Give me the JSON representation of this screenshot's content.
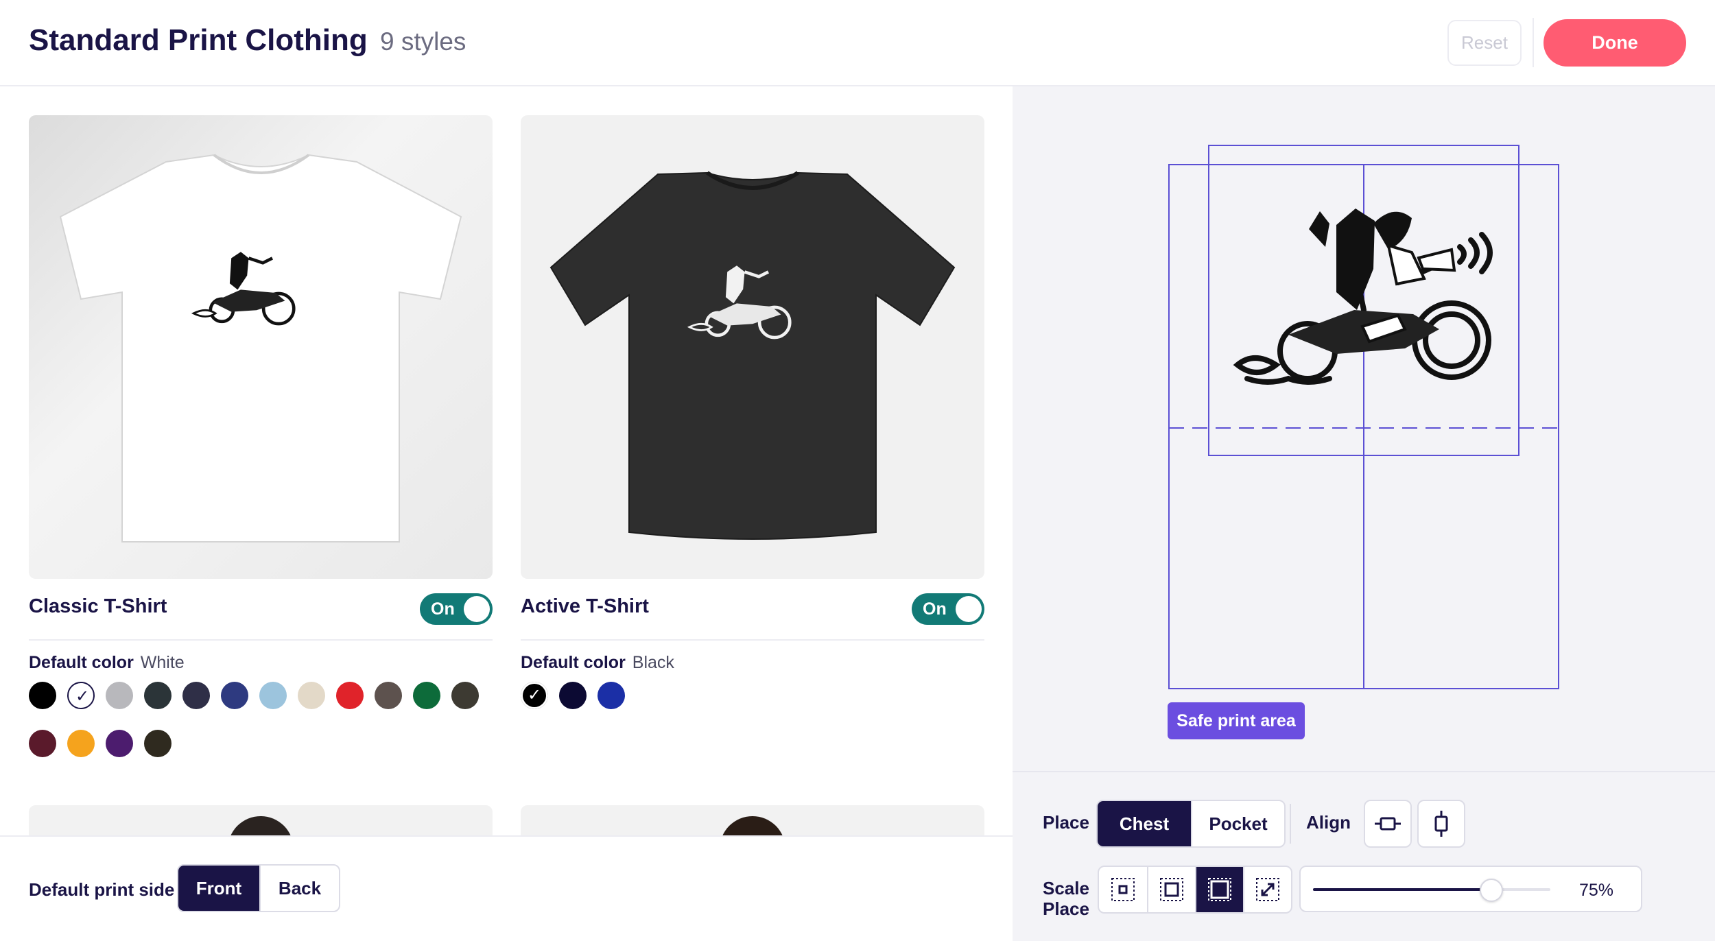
{
  "header": {
    "title": "Standard Print Clothing",
    "subtitle": "9 styles",
    "reset_label": "Reset",
    "done_label": "Done"
  },
  "products": [
    {
      "name": "Classic T-Shirt",
      "toggle_label": "On",
      "default_color_label": "Default color",
      "default_color_value": "White",
      "swatches": [
        "#000000",
        "#ffffff",
        "#b8b8bc",
        "#2b3438",
        "#2f2f47",
        "#2e3a80",
        "#9cc4dd",
        "#e3d9c8",
        "#e0232a",
        "#5d524e",
        "#0d6b3a",
        "#3d3a32",
        "#5a1a2b",
        "#f5a31d",
        "#4c1c6e",
        "#2f2a1f"
      ],
      "selected_swatch": 1
    },
    {
      "name": "Active T-Shirt",
      "toggle_label": "On",
      "default_color_label": "Default color",
      "default_color_value": "Black",
      "swatches": [
        "#000000",
        "#0c0a33",
        "#1b2fa6"
      ],
      "selected_swatch": 0
    }
  ],
  "print_side": {
    "label": "Default print side",
    "options": [
      "Front",
      "Back"
    ],
    "selected": "Front"
  },
  "editor": {
    "safe_area_label": "Safe print area",
    "place_label": "Place",
    "place_options": [
      "Chest",
      "Pocket"
    ],
    "place_selected": "Chest",
    "align_label": "Align",
    "align_icons": [
      "align-horizontal-center-icon",
      "align-vertical-center-icon"
    ],
    "scale_label": "Scale",
    "scale_icons": [
      "scale-small-icon",
      "scale-medium-icon",
      "scale-large-icon",
      "scale-fit-icon"
    ],
    "scale_selected": 2,
    "scale_value": 0.75,
    "scale_display": "75%"
  },
  "colors": {
    "navy": "#1a1446",
    "accent": "#ff5c72",
    "toggle_on": "#127a76",
    "guide": "#5b4fd4",
    "safe_button": "#6b4ee0"
  }
}
